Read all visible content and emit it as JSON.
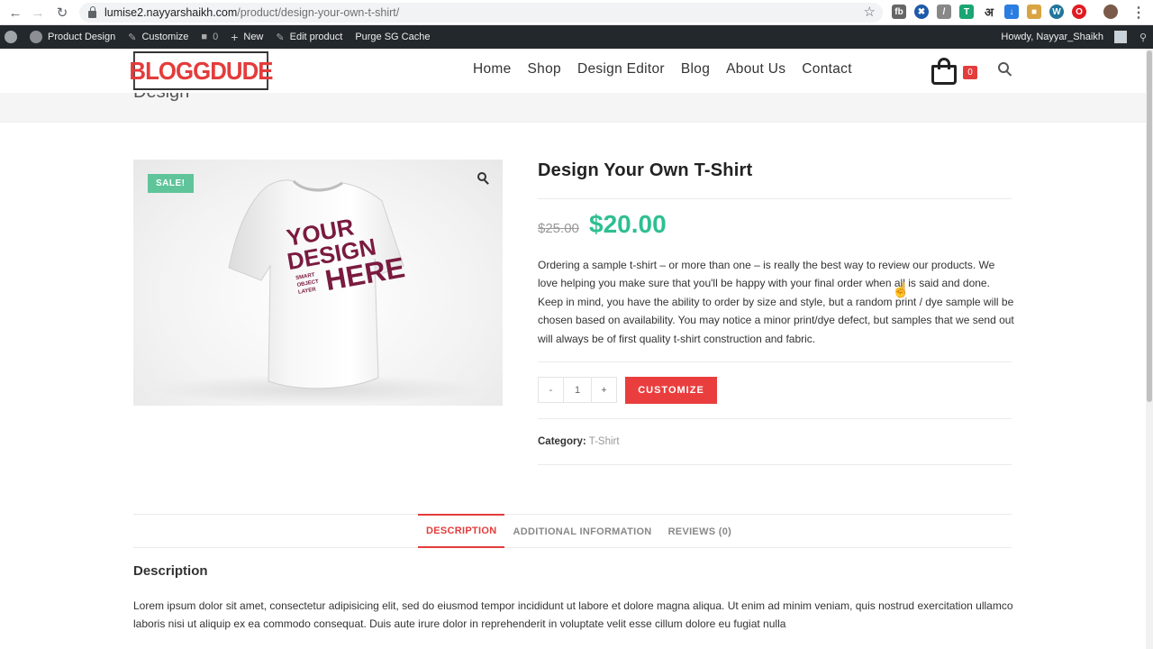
{
  "browser": {
    "url_host": "lumise2.nayyarshaikh.com",
    "url_path": "/product/design-your-own-t-shirt/"
  },
  "adminbar": {
    "site": "Product Design",
    "customize": "Customize",
    "comments": "0",
    "new": "New",
    "edit": "Edit product",
    "purge": "Purge SG Cache",
    "howdy": "Howdy, Nayyar_Shaikh"
  },
  "header": {
    "logo": "BLOGGDUDE",
    "nav": [
      "Home",
      "Shop",
      "Design Editor",
      "Blog",
      "About Us",
      "Contact"
    ],
    "cart_count": "0"
  },
  "page": {
    "title_fragment": "Design"
  },
  "product": {
    "sale_badge": "SALE!",
    "title": "Design Your Own T-Shirt",
    "old_price": "$25.00",
    "new_price": "$20.00",
    "short_description": "Ordering a sample t-shirt – or more than one – is really the best way to review our products. We love helping you make sure that you'll be happy with your final order when all is said and done. Keep in mind, you have the ability to order by size and style, but a random print / dye sample will be chosen based on availability. You may notice a minor print/dye defect, but samples that we send out will always be of first quality t-shirt construction and fabric.",
    "qty_minus": "-",
    "qty_value": "1",
    "qty_plus": "+",
    "customize_label": "CUSTOMIZE",
    "category_label": "Category:",
    "category_value": "T-Shirt",
    "tshirt_print": [
      "YOUR",
      "DESIGN",
      "HERE",
      "SMART",
      "OBJECT",
      "LAYER"
    ]
  },
  "tabs": {
    "items": [
      "DESCRIPTION",
      "ADDITIONAL INFORMATION",
      "REVIEWS (0)"
    ],
    "active": "DESCRIPTION"
  },
  "description": {
    "heading": "Description",
    "body": "Lorem ipsum dolor sit amet, consectetur adipisicing elit, sed do eiusmod tempor incididunt ut labore et dolore magna aliqua. Ut enim ad minim veniam, quis nostrud exercitation ullamco laboris nisi ut aliquip ex ea commodo consequat. Duis aute irure dolor in reprehenderit in voluptate velit esse cillum dolore eu fugiat nulla"
  },
  "colors": {
    "accent_red": "#e43c3c",
    "price_green": "#2ebf91",
    "sale_green": "#5fc49a",
    "adminbar": "#23282d"
  }
}
